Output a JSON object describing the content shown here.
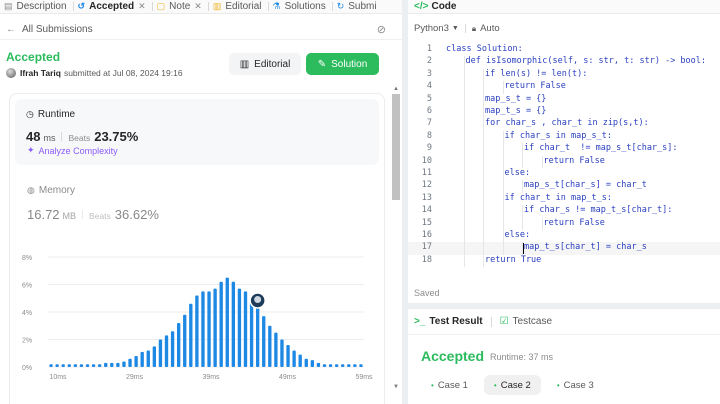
{
  "left_tabs": [
    {
      "label": "Description",
      "icon": "description-icon"
    },
    {
      "label": "Accepted",
      "icon": "history-icon",
      "active": true,
      "closable": true
    },
    {
      "label": "Note",
      "icon": "note-icon",
      "closable": true
    },
    {
      "label": "Editorial",
      "icon": "book-icon"
    },
    {
      "label": "Solutions",
      "icon": "flask-icon"
    },
    {
      "label": "Submi",
      "icon": "submissions-icon"
    }
  ],
  "subheader": {
    "back_label": "All Submissions"
  },
  "submission": {
    "status": "Accepted",
    "user": "Ifrah Tariq",
    "submitted_text": "submitted at Jul 08, 2024 19:16"
  },
  "buttons": {
    "editorial": "Editorial",
    "solution": "Solution"
  },
  "runtime": {
    "title": "Runtime",
    "value": "48",
    "unit": "ms",
    "beats_label": "Beats",
    "beats_value": "23.75%",
    "analyze_label": "Analyze Complexity"
  },
  "memory": {
    "title": "Memory",
    "value": "16.72",
    "unit": "MB",
    "beats_label": "Beats",
    "beats_value": "36.62%"
  },
  "chart_data": {
    "type": "bar",
    "x_tick_labels": [
      "10ms",
      "29ms",
      "39ms",
      "49ms",
      "59ms"
    ],
    "y_tick_labels": [
      "0%",
      "2%",
      "4%",
      "6%",
      "8%"
    ],
    "ylim": [
      0,
      8
    ],
    "values": [
      0.2,
      0.2,
      0.2,
      0.2,
      0.2,
      0.2,
      0.2,
      0.2,
      0.2,
      0.3,
      0.3,
      0.3,
      0.4,
      0.6,
      0.8,
      1.1,
      1.2,
      1.5,
      2.0,
      2.3,
      2.6,
      3.2,
      3.8,
      4.6,
      5.2,
      5.5,
      5.5,
      5.7,
      6.2,
      6.5,
      6.2,
      5.7,
      5.5,
      4.9,
      4.4,
      3.7,
      3.0,
      2.5,
      2.0,
      1.6,
      1.2,
      0.9,
      0.6,
      0.5,
      0.3,
      0.2,
      0.2,
      0.2,
      0.2,
      0.2,
      0.2,
      0.2
    ],
    "marker_index": 34,
    "bar_color": "#1e88e5",
    "grid": true
  },
  "code_panel": {
    "title": "Code",
    "language": "Python3",
    "auto_label": "Auto",
    "saved_label": "Saved",
    "lines": [
      {
        "n": "1",
        "indent": 0,
        "text": "class Solution:"
      },
      {
        "n": "2",
        "indent": 1,
        "text": "def isIsomorphic(self, s: str, t: str) -> bool:"
      },
      {
        "n": "3",
        "indent": 2,
        "text": "if len(s) != len(t):"
      },
      {
        "n": "4",
        "indent": 3,
        "text": "return False"
      },
      {
        "n": "5",
        "indent": 2,
        "text": "map_s_t = {}"
      },
      {
        "n": "6",
        "indent": 2,
        "text": "map_t_s = {}"
      },
      {
        "n": "7",
        "indent": 2,
        "text": "for char_s , char_t in zip(s,t):"
      },
      {
        "n": "8",
        "indent": 3,
        "text": "if char_s in map_s_t:"
      },
      {
        "n": "9",
        "indent": 4,
        "text": "if char_t  != map_s_t[char_s]:"
      },
      {
        "n": "10",
        "indent": 5,
        "text": "return False"
      },
      {
        "n": "11",
        "indent": 3,
        "text": "else:"
      },
      {
        "n": "12",
        "indent": 4,
        "text": "map_s_t[char_s] = char_t"
      },
      {
        "n": "13",
        "indent": 3,
        "text": "if char_t in map_t_s:"
      },
      {
        "n": "14",
        "indent": 4,
        "text": "if char_s != map_t_s[char_t]:"
      },
      {
        "n": "15",
        "indent": 5,
        "text": "return False"
      },
      {
        "n": "16",
        "indent": 3,
        "text": "else:"
      },
      {
        "n": "17",
        "indent": 4,
        "text": "map_t_s[char_t] = char_s",
        "current": true
      },
      {
        "n": "18",
        "indent": 2,
        "text": "return True"
      }
    ]
  },
  "test_panel": {
    "tab_result": "Test Result",
    "tab_testcase": "Testcase",
    "status": "Accepted",
    "runtime": "Runtime: 37 ms",
    "cases": [
      {
        "label": "Case 1"
      },
      {
        "label": "Case 2",
        "active": true
      },
      {
        "label": "Case 3"
      }
    ]
  },
  "colors": {
    "accent_green": "#2cbb5d",
    "bar_blue": "#1e88e5",
    "purple": "#8b5cf6"
  }
}
